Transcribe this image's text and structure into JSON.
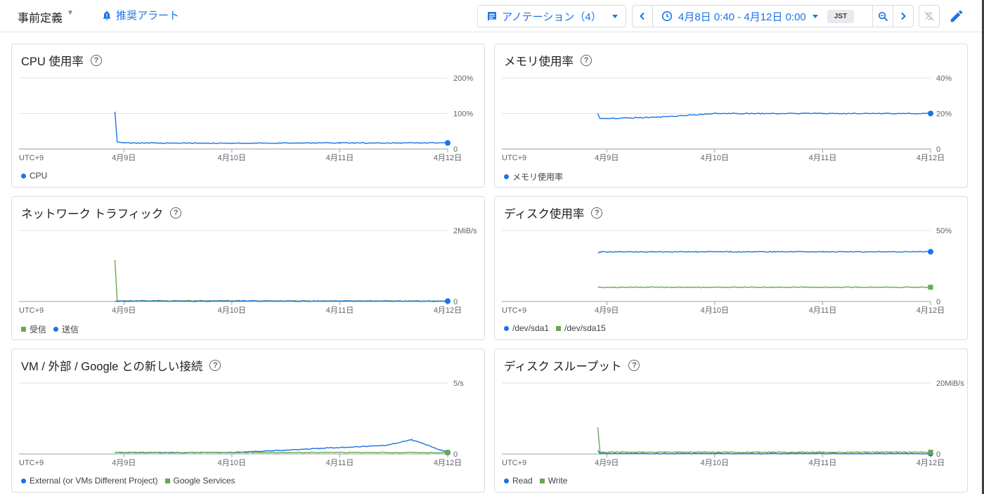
{
  "header": {
    "title": "事前定義",
    "alert_link": "推奨アラート",
    "annotations": "アノテーション（4）",
    "time_range": "4月8日 0:40 - 4月12日 0:00",
    "timezone": "JST"
  },
  "colors": {
    "blue": "#1a73e8",
    "green": "#6aa84f",
    "accent": "#1a73e8"
  },
  "icons": [
    "bell-icon",
    "annotation-icon",
    "chevron-left-icon",
    "clock-icon",
    "chevron-down-icon",
    "zoom-icon",
    "chevron-right-icon",
    "sync-off-icon",
    "pencil-icon"
  ],
  "xaxis": {
    "tz": "UTC+9",
    "ticks": [
      "4月9日",
      "4月10日",
      "4月11日",
      "4月12日"
    ]
  },
  "cards": [
    {
      "title": "CPU 使用率",
      "y_top": "200%",
      "y_mid": "100%",
      "y_zero": "0",
      "legend": [
        {
          "label": "CPU",
          "color": "#1a73e8",
          "shape": "dot"
        }
      ]
    },
    {
      "title": "メモリ使用率",
      "y_top": "40%",
      "y_mid": "20%",
      "y_zero": "0",
      "legend": [
        {
          "label": "メモリ使用率",
          "color": "#1a73e8",
          "shape": "dot"
        }
      ]
    },
    {
      "title": "ネットワーク トラフィック",
      "y_top": "2MiB/s",
      "y_mid": "",
      "y_zero": "0",
      "legend": [
        {
          "label": "受信",
          "color": "#6aa84f",
          "shape": "square"
        },
        {
          "label": "送信",
          "color": "#1a73e8",
          "shape": "dot"
        }
      ]
    },
    {
      "title": "ディスク使用率",
      "y_top": "50%",
      "y_mid": "",
      "y_zero": "0",
      "legend": [
        {
          "label": "/dev/sda1",
          "color": "#1a73e8",
          "shape": "dot"
        },
        {
          "label": "/dev/sda15",
          "color": "#6aa84f",
          "shape": "square"
        }
      ]
    },
    {
      "title": "VM / 外部 / Google との新しい接続",
      "y_top": "5/s",
      "y_mid": "",
      "y_zero": "0",
      "legend": [
        {
          "label": "External (or VMs Different Project)",
          "color": "#1a73e8",
          "shape": "dot"
        },
        {
          "label": "Google Services",
          "color": "#6aa84f",
          "shape": "square"
        }
      ]
    },
    {
      "title": "ディスク スループット",
      "y_top": "20MiB/s",
      "y_mid": "",
      "y_zero": "0",
      "legend": [
        {
          "label": "Read",
          "color": "#1a73e8",
          "shape": "dot"
        },
        {
          "label": "Write",
          "color": "#6aa84f",
          "shape": "square"
        }
      ]
    }
  ],
  "chart_data": [
    {
      "type": "line",
      "title": "CPU 使用率",
      "ylim": [
        0,
        200
      ],
      "x_range": [
        "4月8日 0:40",
        "4月12日 0:00"
      ],
      "series": [
        {
          "name": "CPU",
          "color": "#1a73e8",
          "points": [
            [
              "4月8日 22:00",
              105
            ],
            [
              "4月8日 22:30",
              20
            ],
            [
              "4月9日 0:00",
              17
            ],
            [
              "4月10日 0:00",
              16
            ],
            [
              "4月11日 0:00",
              17
            ],
            [
              "4月12日 0:00",
              17
            ]
          ]
        }
      ]
    },
    {
      "type": "line",
      "title": "メモリ使用率",
      "ylim": [
        0,
        40
      ],
      "x_range": [
        "4月8日 0:40",
        "4月12日 0:00"
      ],
      "series": [
        {
          "name": "メモリ使用率",
          "color": "#1a73e8",
          "points": [
            [
              "4月8日 22:00",
              20
            ],
            [
              "4月8日 22:30",
              17
            ],
            [
              "4月9日 12:00",
              18
            ],
            [
              "4月10日 0:00",
              20
            ],
            [
              "4月11日 0:00",
              20
            ],
            [
              "4月12日 0:00",
              20
            ]
          ]
        }
      ]
    },
    {
      "type": "line",
      "title": "ネットワーク トラフィック",
      "ylim": [
        0,
        2
      ],
      "unit": "MiB/s",
      "x_range": [
        "4月8日 0:40",
        "4月12日 0:00"
      ],
      "series": [
        {
          "name": "受信",
          "color": "#6aa84f",
          "points": [
            [
              "4月8日 22:00",
              1.17
            ],
            [
              "4月8日 22:30",
              0.02
            ],
            [
              "4月12日 0:00",
              0.01
            ]
          ]
        },
        {
          "name": "送信",
          "color": "#1a73e8",
          "points": [
            [
              "4月8日 22:00",
              0.01
            ],
            [
              "4月12日 0:00",
              0.01
            ]
          ]
        }
      ]
    },
    {
      "type": "line",
      "title": "ディスク使用率",
      "ylim": [
        0,
        50
      ],
      "x_range": [
        "4月8日 0:40",
        "4月12日 0:00"
      ],
      "series": [
        {
          "name": "/dev/sda1",
          "color": "#1a73e8",
          "points": [
            [
              "4月8日 22:00",
              34
            ],
            [
              "4月8日 22:30",
              35
            ],
            [
              "4月9日 20:00",
              35
            ],
            [
              "4月12日 0:00",
              35
            ]
          ]
        },
        {
          "name": "/dev/sda15",
          "color": "#6aa84f",
          "points": [
            [
              "4月8日 22:00",
              10
            ],
            [
              "4月12日 0:00",
              10
            ]
          ]
        }
      ]
    },
    {
      "type": "line",
      "title": "VM / 外部 / Google との新しい接続",
      "ylim": [
        0,
        5
      ],
      "unit": "/s",
      "x_range": [
        "4月8日 0:40",
        "4月12日 0:00"
      ],
      "series": [
        {
          "name": "External (or VMs Different Project)",
          "color": "#1a73e8",
          "points": [
            [
              "4月8日 22:00",
              0.1
            ],
            [
              "4月10日 0:00",
              0.1
            ],
            [
              "4月11日 10:00",
              0.6
            ],
            [
              "4月11日 16:00",
              1.0
            ],
            [
              "4月12日 0:00",
              0.1
            ]
          ]
        },
        {
          "name": "Google Services",
          "color": "#6aa84f",
          "points": [
            [
              "4月8日 22:00",
              0.1
            ],
            [
              "4月12日 0:00",
              0.1
            ]
          ]
        }
      ]
    },
    {
      "type": "line",
      "title": "ディスク スループット",
      "ylim": [
        0,
        20
      ],
      "unit": "MiB/s",
      "x_range": [
        "4月8日 0:40",
        "4月12日 0:00"
      ],
      "series": [
        {
          "name": "Read",
          "color": "#1a73e8",
          "points": [
            [
              "4月8日 22:00",
              1.0
            ],
            [
              "4月8日 22:30",
              0.1
            ],
            [
              "4月12日 0:00",
              0.1
            ]
          ]
        },
        {
          "name": "Write",
          "color": "#6aa84f",
          "points": [
            [
              "4月8日 22:00",
              7.5
            ],
            [
              "4月8日 22:30",
              0.5
            ],
            [
              "4月12日 0:00",
              0.5
            ]
          ]
        }
      ]
    }
  ]
}
